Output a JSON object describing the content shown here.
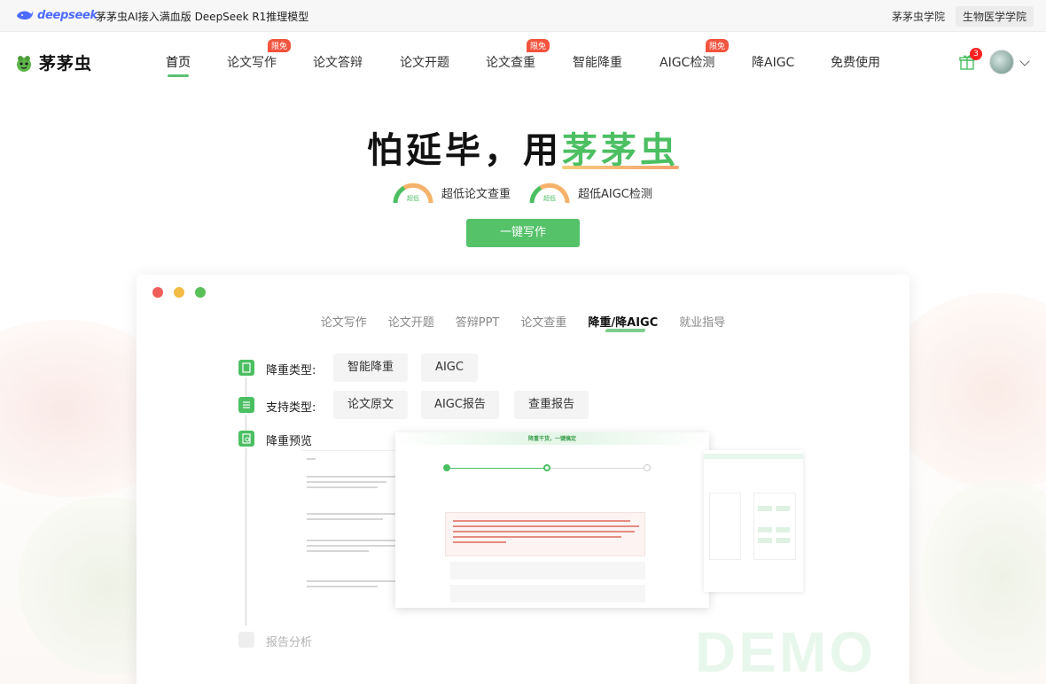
{
  "topbar": {
    "logo_text": "deepseek",
    "announcement": "茅茅虫AI接入满血版 DeepSeek R1推理模型",
    "links": [
      "茅茅虫学院",
      "生物医学学院"
    ]
  },
  "navbar": {
    "brand": "茅茅虫",
    "badge_label": "限免",
    "items": [
      {
        "label": "首页",
        "active": true,
        "badge": false
      },
      {
        "label": "论文写作",
        "active": false,
        "badge": true
      },
      {
        "label": "论文答辩",
        "active": false,
        "badge": false
      },
      {
        "label": "论文开题",
        "active": false,
        "badge": false
      },
      {
        "label": "论文查重",
        "active": false,
        "badge": true
      },
      {
        "label": "智能降重",
        "active": false,
        "badge": false
      },
      {
        "label": "AIGC检测",
        "active": false,
        "badge": true
      },
      {
        "label": "降AIGC",
        "active": false,
        "badge": false
      },
      {
        "label": "免费使用",
        "active": false,
        "badge": false
      }
    ],
    "gift_count": "3",
    "icons": [
      "gift-icon",
      "avatar",
      "chevron-down-icon"
    ]
  },
  "hero": {
    "headline_prefix": "怕延毕，用",
    "headline_highlight": "茅茅虫",
    "features": [
      {
        "gauge_label": "超低",
        "text": "超低论文查重"
      },
      {
        "gauge_label": "超低",
        "text": "超低AIGC检测"
      }
    ],
    "cta": "一键写作"
  },
  "demo_window": {
    "tabs": [
      "论文写作",
      "论文开题",
      "答辩PPT",
      "论文查重",
      "降重/降AIGC",
      "就业指导"
    ],
    "active_tab": "降重/降AIGC",
    "steps": {
      "reduce_type_label": "降重类型:",
      "reduce_types": [
        "智能降重",
        "AIGC"
      ],
      "support_type_label": "支持类型:",
      "support_types": [
        "论文原文",
        "AIGC报告",
        "查重报告"
      ],
      "preview_label": "降重预览",
      "report_label": "报告分析"
    },
    "preview_title": "降重干货，一键搞定",
    "watermark": "DEMO"
  },
  "colors": {
    "brand_green": "#4cbf63",
    "badge_red": "#f2543e",
    "deepseek_blue": "#4d6bfe"
  }
}
